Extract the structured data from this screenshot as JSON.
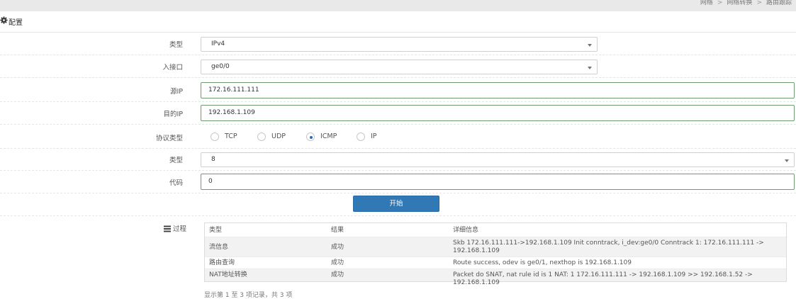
{
  "breadcrumb": [
    "网络",
    "网络转换",
    "路由跟踪"
  ],
  "section": {
    "title": "配置"
  },
  "form": {
    "type_label": "类型",
    "type_value": "IPv4",
    "ingress_label": "入接口",
    "ingress_value": "ge0/0",
    "src_ip_label": "源IP",
    "src_ip_value": "172.16.111.111",
    "dst_ip_label": "目的IP",
    "dst_ip_value": "192.168.1.109",
    "protocol_label": "协议类型",
    "protocol_options": [
      "TCP",
      "UDP",
      "ICMP",
      "IP"
    ],
    "protocol_selected": "ICMP",
    "icmp_type_label": "类型",
    "icmp_type_value": "8",
    "code_label": "代码",
    "code_value": "0",
    "start_label": "开始"
  },
  "process": {
    "label": "过程",
    "headers": [
      "类型",
      "结果",
      "详细信息"
    ],
    "rows": [
      [
        "流信息",
        "成功",
        "Skb 172.16.111.111->192.168.1.109 Init conntrack, i_dev:ge0/0 Conntrack 1: 172.16.111.111 -> 192.168.1.109"
      ],
      [
        "路由查询",
        "成功",
        "Route success, odev is ge0/1, nexthop is 192.168.1.109"
      ],
      [
        "NAT地址转换",
        "成功",
        "Packet do SNAT, nat rule id is 1 NAT: 1 172.16.111.111 -> 192.168.1.109 >> 192.168.1.52 -> 192.168.1.109"
      ]
    ],
    "footer": "显示第 1 至 3 项记录，共 3 项"
  }
}
